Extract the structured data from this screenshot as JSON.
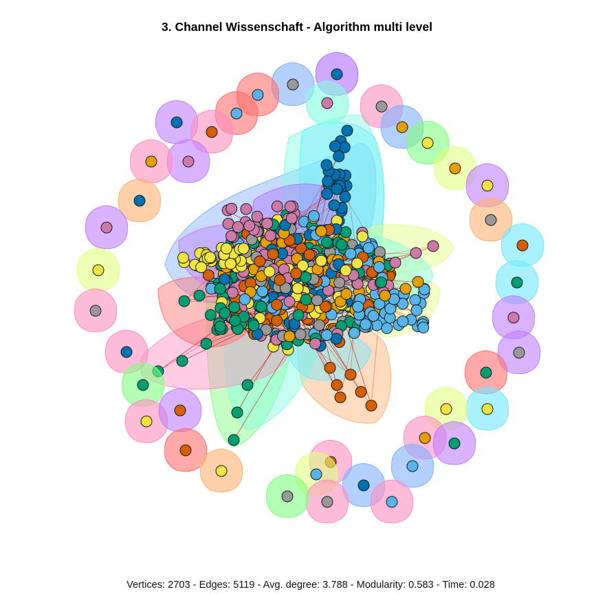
{
  "title": "3. Channel Wissenschaft - Algorithm multi level",
  "caption": "Vertices: 2703 - Edges: 5119 - Avg. degree: 3.788 - Modularity: 0.583 - Time: 0.028",
  "palette": {
    "vertex_colors": [
      "#E69F00",
      "#56B4E9",
      "#009E73",
      "#F0E442",
      "#0072B2",
      "#D55E00",
      "#CC79A7",
      "#999999"
    ],
    "hull_colors": [
      "#ff8fc0",
      "#c080ff",
      "#80b0ff",
      "#80ffe0",
      "#80ff80",
      "#e0ff80",
      "#ffb070",
      "#ff7070",
      "#70e8ff",
      "#b070ff"
    ],
    "edge_color": "#cc0000"
  }
}
